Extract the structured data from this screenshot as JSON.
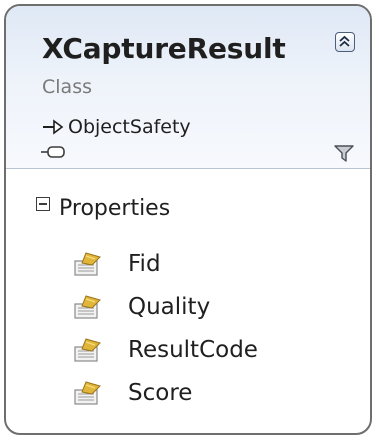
{
  "class_box": {
    "name": "XCaptureResult",
    "stereotype": "Class",
    "base": {
      "icon": "inheritance-arrow-icon",
      "name": "ObjectSafety"
    },
    "interface_icon": "lollipop-interface-icon",
    "filter_icon": "funnel-filter-icon",
    "collapse_icon": "double-chevron-up-icon"
  },
  "properties_section": {
    "label": "Properties",
    "toggle_icon": "minus-box-icon",
    "items": [
      {
        "label": "Fid",
        "icon": "property-icon"
      },
      {
        "label": "Quality",
        "icon": "property-icon"
      },
      {
        "label": "ResultCode",
        "icon": "property-icon"
      },
      {
        "label": "Score",
        "icon": "property-icon"
      }
    ]
  },
  "colors": {
    "border": "#6e6e6e",
    "header_gradient_top": "#dfe8f5",
    "header_gradient_bottom": "#f7f9fd",
    "property_icon_gold": "#e0b53a",
    "property_icon_gray": "#8a8a8a"
  }
}
